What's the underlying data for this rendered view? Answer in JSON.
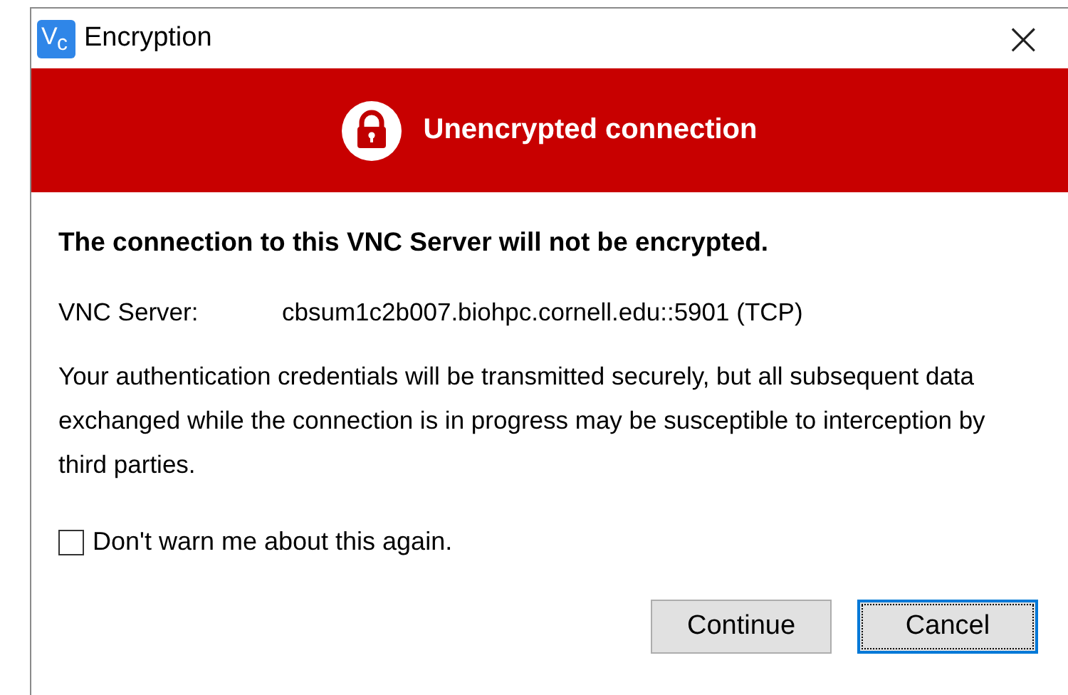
{
  "window": {
    "logo": [
      "V",
      "c"
    ],
    "title": "Encryption",
    "close": "×"
  },
  "banner": {
    "title": "Unencrypted connection"
  },
  "heading": "The connection to this VNC Server will not be encrypted.",
  "server": {
    "label": "VNC Server:",
    "value": "cbsum1c2b007.biohpc.cornell.edu::5901 (TCP)"
  },
  "message": "Your authentication credentials will be transmitted securely, but all subsequent data exchanged while the connection is in progress may be susceptible to interception by third parties.",
  "checkbox": {
    "label": "Don't warn me about this again.",
    "checked": false
  },
  "buttons": [
    {
      "label": "Continue",
      "focused": false
    },
    {
      "label": "Cancel",
      "focused": true
    }
  ]
}
